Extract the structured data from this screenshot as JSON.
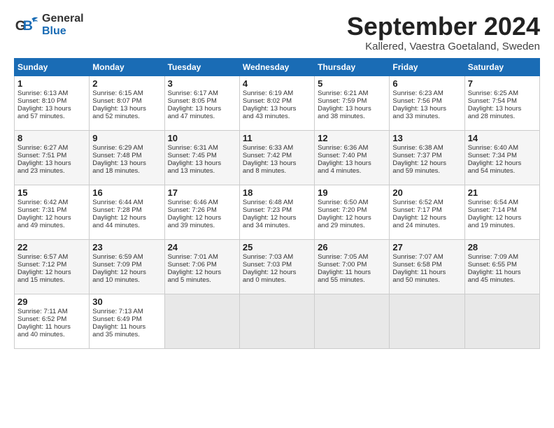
{
  "header": {
    "logo_general": "General",
    "logo_blue": "Blue",
    "title": "September 2024",
    "subtitle": "Kallered, Vaestra Goetaland, Sweden"
  },
  "days_of_week": [
    "Sunday",
    "Monday",
    "Tuesday",
    "Wednesday",
    "Thursday",
    "Friday",
    "Saturday"
  ],
  "weeks": [
    [
      {
        "day": "1",
        "line1": "Sunrise: 6:13 AM",
        "line2": "Sunset: 8:10 PM",
        "line3": "Daylight: 13 hours",
        "line4": "and 57 minutes."
      },
      {
        "day": "2",
        "line1": "Sunrise: 6:15 AM",
        "line2": "Sunset: 8:07 PM",
        "line3": "Daylight: 13 hours",
        "line4": "and 52 minutes."
      },
      {
        "day": "3",
        "line1": "Sunrise: 6:17 AM",
        "line2": "Sunset: 8:05 PM",
        "line3": "Daylight: 13 hours",
        "line4": "and 47 minutes."
      },
      {
        "day": "4",
        "line1": "Sunrise: 6:19 AM",
        "line2": "Sunset: 8:02 PM",
        "line3": "Daylight: 13 hours",
        "line4": "and 43 minutes."
      },
      {
        "day": "5",
        "line1": "Sunrise: 6:21 AM",
        "line2": "Sunset: 7:59 PM",
        "line3": "Daylight: 13 hours",
        "line4": "and 38 minutes."
      },
      {
        "day": "6",
        "line1": "Sunrise: 6:23 AM",
        "line2": "Sunset: 7:56 PM",
        "line3": "Daylight: 13 hours",
        "line4": "and 33 minutes."
      },
      {
        "day": "7",
        "line1": "Sunrise: 6:25 AM",
        "line2": "Sunset: 7:54 PM",
        "line3": "Daylight: 13 hours",
        "line4": "and 28 minutes."
      }
    ],
    [
      {
        "day": "8",
        "line1": "Sunrise: 6:27 AM",
        "line2": "Sunset: 7:51 PM",
        "line3": "Daylight: 13 hours",
        "line4": "and 23 minutes."
      },
      {
        "day": "9",
        "line1": "Sunrise: 6:29 AM",
        "line2": "Sunset: 7:48 PM",
        "line3": "Daylight: 13 hours",
        "line4": "and 18 minutes."
      },
      {
        "day": "10",
        "line1": "Sunrise: 6:31 AM",
        "line2": "Sunset: 7:45 PM",
        "line3": "Daylight: 13 hours",
        "line4": "and 13 minutes."
      },
      {
        "day": "11",
        "line1": "Sunrise: 6:33 AM",
        "line2": "Sunset: 7:42 PM",
        "line3": "Daylight: 13 hours",
        "line4": "and 8 minutes."
      },
      {
        "day": "12",
        "line1": "Sunrise: 6:36 AM",
        "line2": "Sunset: 7:40 PM",
        "line3": "Daylight: 13 hours",
        "line4": "and 4 minutes."
      },
      {
        "day": "13",
        "line1": "Sunrise: 6:38 AM",
        "line2": "Sunset: 7:37 PM",
        "line3": "Daylight: 12 hours",
        "line4": "and 59 minutes."
      },
      {
        "day": "14",
        "line1": "Sunrise: 6:40 AM",
        "line2": "Sunset: 7:34 PM",
        "line3": "Daylight: 12 hours",
        "line4": "and 54 minutes."
      }
    ],
    [
      {
        "day": "15",
        "line1": "Sunrise: 6:42 AM",
        "line2": "Sunset: 7:31 PM",
        "line3": "Daylight: 12 hours",
        "line4": "and 49 minutes."
      },
      {
        "day": "16",
        "line1": "Sunrise: 6:44 AM",
        "line2": "Sunset: 7:28 PM",
        "line3": "Daylight: 12 hours",
        "line4": "and 44 minutes."
      },
      {
        "day": "17",
        "line1": "Sunrise: 6:46 AM",
        "line2": "Sunset: 7:26 PM",
        "line3": "Daylight: 12 hours",
        "line4": "and 39 minutes."
      },
      {
        "day": "18",
        "line1": "Sunrise: 6:48 AM",
        "line2": "Sunset: 7:23 PM",
        "line3": "Daylight: 12 hours",
        "line4": "and 34 minutes."
      },
      {
        "day": "19",
        "line1": "Sunrise: 6:50 AM",
        "line2": "Sunset: 7:20 PM",
        "line3": "Daylight: 12 hours",
        "line4": "and 29 minutes."
      },
      {
        "day": "20",
        "line1": "Sunrise: 6:52 AM",
        "line2": "Sunset: 7:17 PM",
        "line3": "Daylight: 12 hours",
        "line4": "and 24 minutes."
      },
      {
        "day": "21",
        "line1": "Sunrise: 6:54 AM",
        "line2": "Sunset: 7:14 PM",
        "line3": "Daylight: 12 hours",
        "line4": "and 19 minutes."
      }
    ],
    [
      {
        "day": "22",
        "line1": "Sunrise: 6:57 AM",
        "line2": "Sunset: 7:12 PM",
        "line3": "Daylight: 12 hours",
        "line4": "and 15 minutes."
      },
      {
        "day": "23",
        "line1": "Sunrise: 6:59 AM",
        "line2": "Sunset: 7:09 PM",
        "line3": "Daylight: 12 hours",
        "line4": "and 10 minutes."
      },
      {
        "day": "24",
        "line1": "Sunrise: 7:01 AM",
        "line2": "Sunset: 7:06 PM",
        "line3": "Daylight: 12 hours",
        "line4": "and 5 minutes."
      },
      {
        "day": "25",
        "line1": "Sunrise: 7:03 AM",
        "line2": "Sunset: 7:03 PM",
        "line3": "Daylight: 12 hours",
        "line4": "and 0 minutes."
      },
      {
        "day": "26",
        "line1": "Sunrise: 7:05 AM",
        "line2": "Sunset: 7:00 PM",
        "line3": "Daylight: 11 hours",
        "line4": "and 55 minutes."
      },
      {
        "day": "27",
        "line1": "Sunrise: 7:07 AM",
        "line2": "Sunset: 6:58 PM",
        "line3": "Daylight: 11 hours",
        "line4": "and 50 minutes."
      },
      {
        "day": "28",
        "line1": "Sunrise: 7:09 AM",
        "line2": "Sunset: 6:55 PM",
        "line3": "Daylight: 11 hours",
        "line4": "and 45 minutes."
      }
    ],
    [
      {
        "day": "29",
        "line1": "Sunrise: 7:11 AM",
        "line2": "Sunset: 6:52 PM",
        "line3": "Daylight: 11 hours",
        "line4": "and 40 minutes."
      },
      {
        "day": "30",
        "line1": "Sunrise: 7:13 AM",
        "line2": "Sunset: 6:49 PM",
        "line3": "Daylight: 11 hours",
        "line4": "and 35 minutes."
      },
      {
        "day": "",
        "line1": "",
        "line2": "",
        "line3": "",
        "line4": ""
      },
      {
        "day": "",
        "line1": "",
        "line2": "",
        "line3": "",
        "line4": ""
      },
      {
        "day": "",
        "line1": "",
        "line2": "",
        "line3": "",
        "line4": ""
      },
      {
        "day": "",
        "line1": "",
        "line2": "",
        "line3": "",
        "line4": ""
      },
      {
        "day": "",
        "line1": "",
        "line2": "",
        "line3": "",
        "line4": ""
      }
    ]
  ]
}
